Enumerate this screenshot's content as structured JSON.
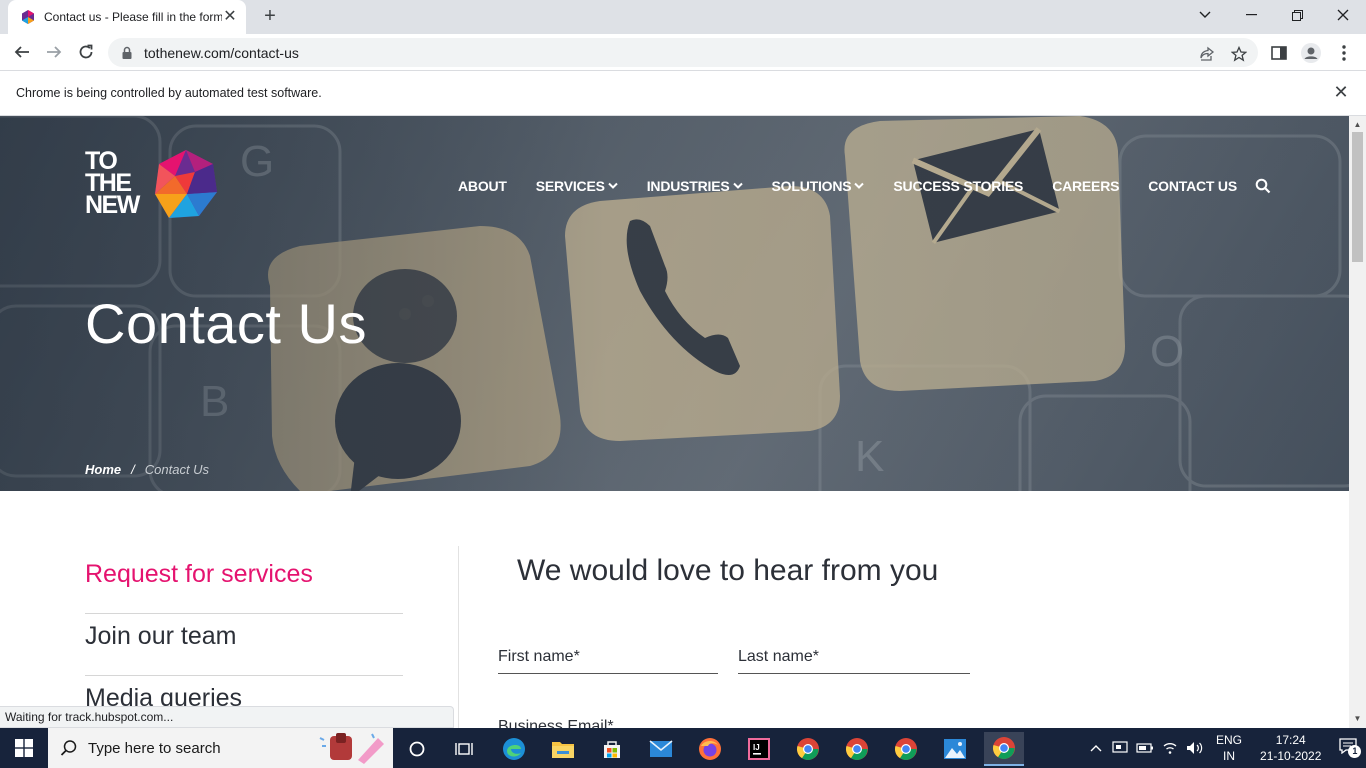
{
  "browser": {
    "tab_title": "Contact us - Please fill in the form",
    "url": "tothenew.com/contact-us",
    "infobar_text": "Chrome is being controlled by automated test software.",
    "status_text": "Waiting for track.hubspot.com..."
  },
  "site": {
    "logo_lines": [
      "TO",
      "THE",
      "NEW"
    ],
    "nav": [
      {
        "label": "ABOUT",
        "dropdown": false
      },
      {
        "label": "SERVICES",
        "dropdown": true
      },
      {
        "label": "INDUSTRIES",
        "dropdown": true
      },
      {
        "label": "SOLUTIONS",
        "dropdown": true
      },
      {
        "label": "SUCCESS STORIES",
        "dropdown": false
      },
      {
        "label": "CAREERS",
        "dropdown": false
      },
      {
        "label": "CONTACT US",
        "dropdown": false
      }
    ],
    "hero_title": "Contact Us",
    "breadcrumb": {
      "home": "Home",
      "separator": "/",
      "current": "Contact Us"
    },
    "accent_color": "#e5136f"
  },
  "side_menu": {
    "items": [
      "Request for services",
      "Join our team",
      "Media queries"
    ]
  },
  "form": {
    "title": "We would love to hear from you",
    "first_name_label": "First name*",
    "last_name_label": "Last name*",
    "email_label": "Business Email*"
  },
  "taskbar": {
    "search_placeholder": "Type here to search",
    "lang_top": "ENG",
    "lang_bottom": "IN",
    "time": "17:24",
    "date": "21-10-2022",
    "notification_count": "1"
  }
}
